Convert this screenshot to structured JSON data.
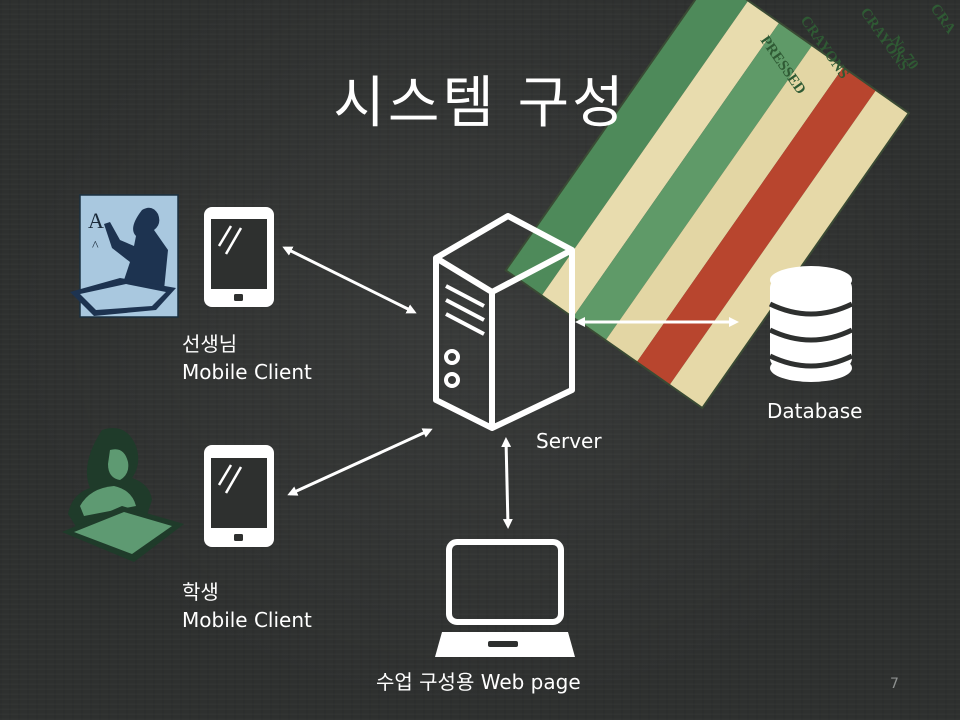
{
  "slide": {
    "title": "시스템 구성",
    "page_number": "7"
  },
  "nodes": {
    "teacher_client": {
      "role": "선생님",
      "type": "Mobile Client"
    },
    "student_client": {
      "role": "학생",
      "type": "Mobile Client"
    },
    "server": {
      "label": "Server"
    },
    "database": {
      "label": "Database"
    },
    "web_page": {
      "label": "수업 구성용 Web page"
    }
  },
  "decor": {
    "crayon_labels": [
      "PRESSED",
      "CRAYONS",
      "No.70",
      "CRAYONS",
      "CRA"
    ]
  },
  "colors": {
    "background": "#2e302f",
    "foreground": "#ffffff",
    "teacher_clipart_bg": "#a9c8df",
    "student_clipart": "#5e9a72",
    "crayon_green": "#4e8a5a",
    "crayon_cream": "#e8dcae",
    "crayon_red": "#b8452e"
  }
}
